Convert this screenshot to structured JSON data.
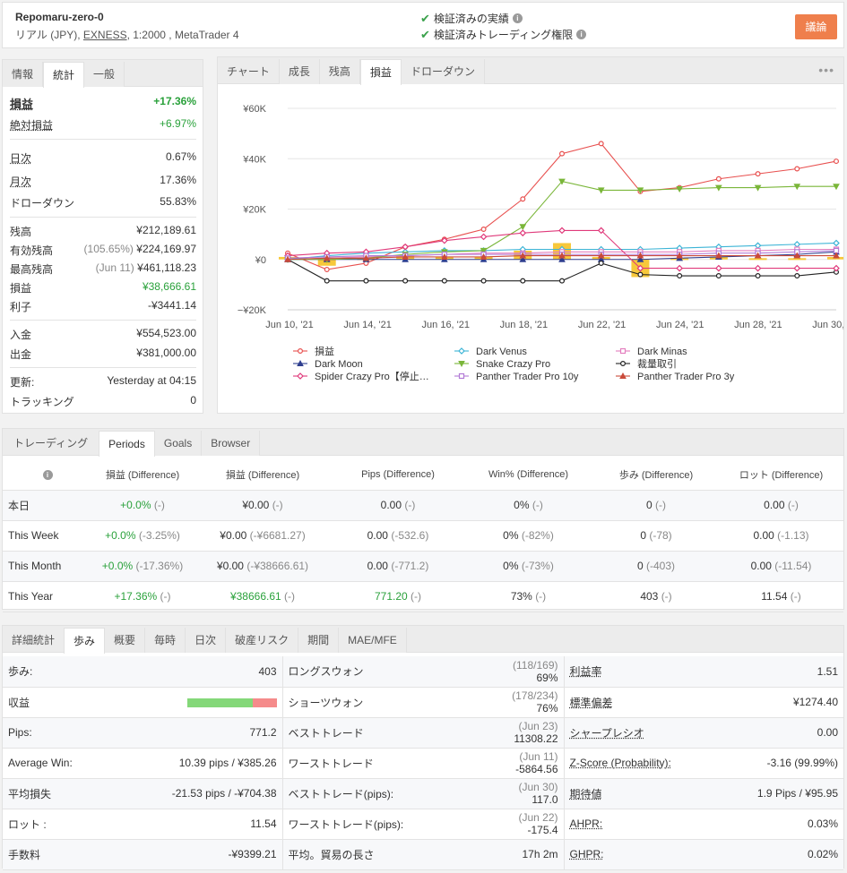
{
  "header": {
    "account_name": "Repomaru-zero-0",
    "account_prefix": "リアル (JPY),",
    "broker": "EXNESS",
    "account_suffix": ", 1:2000 , MetaTrader 4",
    "verified_track": "検証済みの実績",
    "verified_trading": "検証済みトレーディング権限",
    "discuss_label": "議論"
  },
  "stats": {
    "tabs": [
      "情報",
      "統計",
      "一般"
    ],
    "rows": [
      {
        "label": "損益",
        "value": "+17.36%"
      },
      {
        "label": "絶対損益",
        "value": "+6.97%"
      },
      {
        "label": "日次",
        "value": "0.67%"
      },
      {
        "label": "月次",
        "value": "17.36%"
      },
      {
        "label": "ドローダウン",
        "value": "55.83%"
      },
      {
        "label": "残高",
        "value": "¥212,189.61"
      },
      {
        "label": "有効残高",
        "note": "(105.65%)",
        "value": "¥224,169.97"
      },
      {
        "label": "最高残高",
        "note": "(Jun 11)",
        "value": "¥461,118.23"
      },
      {
        "label": "損益",
        "value": "¥38,666.61"
      },
      {
        "label": "利子",
        "value": "-¥3441.14"
      },
      {
        "label": "入金",
        "value": "¥554,523.00"
      },
      {
        "label": "出金",
        "value": "¥381,000.00"
      },
      {
        "label": "更新:",
        "value": "Yesterday at 04:15"
      },
      {
        "label": "トラッキング",
        "value": "0"
      }
    ]
  },
  "chart_tabs": [
    "チャート",
    "成長",
    "残高",
    "損益",
    "ドローダウン"
  ],
  "chart_data": {
    "type": "line",
    "title": "",
    "xlabel": "",
    "ylabel": "",
    "x_ticks": [
      "Jun 10, '21",
      "Jun 14, '21",
      "Jun 16, '21",
      "Jun 18, '21",
      "Jun 22, '21",
      "Jun 24, '21",
      "Jun 28, '21",
      "Jun 30, '21"
    ],
    "y_ticks": [
      "¥60K",
      "¥40K",
      "¥20K",
      "¥0",
      "−¥20K"
    ],
    "ylim": [
      -20000,
      60000
    ],
    "x": [
      "Jun 10",
      "Jun 11",
      "Jun 14",
      "Jun 15",
      "Jun 16",
      "Jun 17",
      "Jun 18",
      "Jun 21",
      "Jun 22",
      "Jun 23",
      "Jun 24",
      "Jun 25",
      "Jun 28",
      "Jun 29",
      "Jun 30"
    ],
    "bars": {
      "name": "",
      "color": "#f7c83b",
      "values": [
        1000,
        -2500,
        500,
        1500,
        1000,
        1000,
        3500,
        6500,
        1000,
        -7000,
        500,
        1000,
        500,
        500,
        1000
      ]
    },
    "series": [
      {
        "name": "損益",
        "color": "#e8504f",
        "marker": "o",
        "values": [
          2500,
          -4000,
          -1500,
          5000,
          8000,
          12000,
          24000,
          42000,
          46000,
          27000,
          28500,
          32000,
          34000,
          36000,
          39000
        ]
      },
      {
        "name": "Dark Venus",
        "color": "#3cb4d6",
        "marker": "d",
        "values": [
          0,
          1500,
          2500,
          3000,
          3500,
          3500,
          4000,
          4000,
          4000,
          4000,
          4500,
          5000,
          5500,
          6000,
          6500
        ]
      },
      {
        "name": "Dark Minas",
        "color": "#e47fbf",
        "marker": "s",
        "values": [
          0,
          500,
          1000,
          1500,
          2000,
          2500,
          2500,
          3000,
          3000,
          3000,
          3000,
          3500,
          3500,
          4000,
          4000
        ]
      },
      {
        "name": "Dark Moon",
        "color": "#2f3f8f",
        "marker": "^",
        "values": [
          0,
          0,
          0,
          0,
          0,
          0,
          0,
          0,
          0,
          0,
          500,
          1000,
          1500,
          2000,
          3000
        ]
      },
      {
        "name": "Snake Crazy Pro",
        "color": "#7ab639",
        "marker": "v",
        "values": [
          0,
          0,
          500,
          2000,
          3000,
          3500,
          13000,
          31000,
          27500,
          27500,
          28000,
          28500,
          28500,
          29000,
          29000
        ]
      },
      {
        "name": "裁量取引",
        "color": "#222222",
        "marker": "o",
        "values": [
          0,
          -8500,
          -8500,
          -8500,
          -8500,
          -8500,
          -8500,
          -8500,
          -1500,
          -6000,
          -6500,
          -6500,
          -6500,
          -6500,
          -5000
        ]
      },
      {
        "name": "Spider Crazy Pro【停止…",
        "color": "#e03a7b",
        "marker": "d",
        "values": [
          1500,
          2500,
          3000,
          5000,
          7500,
          9000,
          10500,
          11500,
          11500,
          -3500,
          -3500,
          -3500,
          -3500,
          -3500,
          -3500
        ]
      },
      {
        "name": "Panther Trader Pro 10y",
        "color": "#b27bd6",
        "marker": "s",
        "values": [
          500,
          1000,
          1500,
          1500,
          2000,
          2000,
          2000,
          2000,
          2000,
          2000,
          2000,
          2500,
          2500,
          3000,
          3500
        ]
      },
      {
        "name": "Panther Trader Pro 3y",
        "color": "#c94a3a",
        "marker": "^",
        "values": [
          0,
          500,
          500,
          1000,
          1000,
          1000,
          1500,
          1500,
          1500,
          1500,
          1500,
          1500,
          1500,
          1500,
          1500
        ]
      }
    ],
    "legend": "bottom",
    "grid": true
  },
  "periods": {
    "tabs": [
      "トレーディング",
      "Periods",
      "Goals",
      "Browser"
    ],
    "headers": [
      "損益 (Difference)",
      "損益 (Difference)",
      "Pips (Difference)",
      "Win% (Difference)",
      "歩み (Difference)",
      "ロット (Difference)"
    ],
    "rows": [
      {
        "label": "本日",
        "cells": [
          [
            "+0.0%",
            "(-)",
            "g"
          ],
          [
            "¥0.00",
            "(-)",
            ""
          ],
          [
            "0.00",
            "(-)",
            ""
          ],
          [
            "0%",
            "(-)",
            ""
          ],
          [
            "0",
            "(-)",
            ""
          ],
          [
            "0.00",
            "(-)",
            ""
          ]
        ]
      },
      {
        "label": "This Week",
        "cells": [
          [
            "+0.0%",
            "(-3.25%)",
            "g"
          ],
          [
            "¥0.00",
            "(-¥6681.27)",
            ""
          ],
          [
            "0.00",
            "(-532.6)",
            ""
          ],
          [
            "0%",
            "(-82%)",
            ""
          ],
          [
            "0",
            "(-78)",
            ""
          ],
          [
            "0.00",
            "(-1.13)",
            ""
          ]
        ]
      },
      {
        "label": "This Month",
        "cells": [
          [
            "+0.0%",
            "(-17.36%)",
            "g"
          ],
          [
            "¥0.00",
            "(-¥38666.61)",
            ""
          ],
          [
            "0.00",
            "(-771.2)",
            ""
          ],
          [
            "0%",
            "(-73%)",
            ""
          ],
          [
            "0",
            "(-403)",
            ""
          ],
          [
            "0.00",
            "(-11.54)",
            ""
          ]
        ]
      },
      {
        "label": "This Year",
        "cells": [
          [
            "+17.36%",
            "(-)",
            "g"
          ],
          [
            "¥38666.61",
            "(-)",
            "g"
          ],
          [
            "771.20",
            "(-)",
            "g"
          ],
          [
            "73%",
            "(-)",
            ""
          ],
          [
            "403",
            "(-)",
            ""
          ],
          [
            "11.54",
            "(-)",
            ""
          ]
        ]
      }
    ]
  },
  "detail": {
    "tabs": [
      "詳細統計",
      "歩み",
      "概要",
      "毎時",
      "日次",
      "破産リスク",
      "期間",
      "MAE/MFE"
    ],
    "rows": [
      [
        [
          "歩み:",
          "",
          "403"
        ],
        [
          "ロングスウォン",
          "(118/169)",
          "69%"
        ],
        [
          "利益率",
          "",
          "1.51"
        ]
      ],
      [
        [
          "収益",
          "",
          ""
        ],
        [
          "ショーツウォン",
          "(178/234)",
          "76%"
        ],
        [
          "標準偏差",
          "",
          "¥1274.40"
        ]
      ],
      [
        [
          "Pips:",
          "",
          "771.2"
        ],
        [
          "ベストトレード",
          "(Jun 23)",
          "11308.22"
        ],
        [
          "シャープレシオ",
          "",
          "0.00"
        ]
      ],
      [
        [
          "Average Win:",
          "",
          "10.39 pips / ¥385.26"
        ],
        [
          "ワーストトレード",
          "(Jun 11)",
          "-5864.56"
        ],
        [
          "Z-Score (Probability):",
          "",
          "-3.16 (99.99%)"
        ]
      ],
      [
        [
          "平均損失",
          "",
          "-21.53 pips / -¥704.38"
        ],
        [
          "ベストトレード(pips):",
          "(Jun 30)",
          "117.0"
        ],
        [
          "期待値",
          "",
          "1.9 Pips / ¥95.95"
        ]
      ],
      [
        [
          "ロット :",
          "",
          "11.54"
        ],
        [
          "ワーストトレード(pips):",
          "(Jun 22)",
          "-175.4"
        ],
        [
          "AHPR:",
          "",
          "0.03%"
        ]
      ],
      [
        [
          "手数料",
          "",
          "-¥9399.21"
        ],
        [
          "平均。貿易の長さ",
          "",
          "17h 2m"
        ],
        [
          "GHPR:",
          "",
          "0.02%"
        ]
      ]
    ],
    "profit_ratio": 0.73
  }
}
